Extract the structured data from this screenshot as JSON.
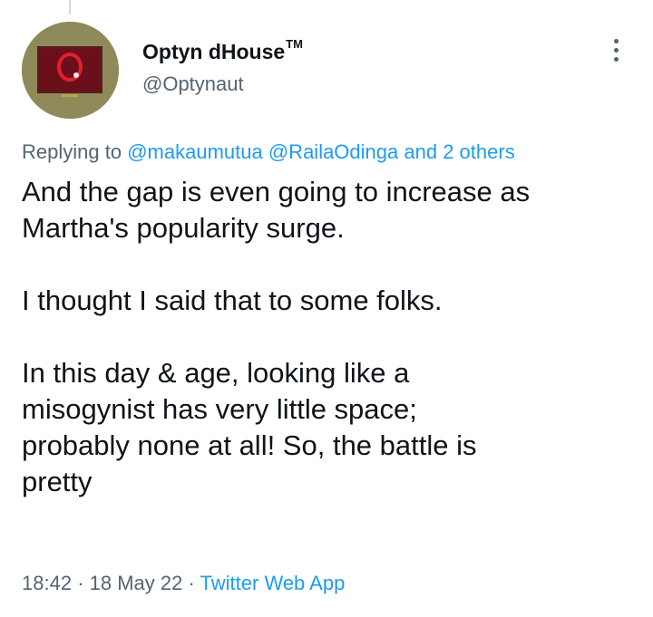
{
  "author": {
    "display_name": "Optyn dHouse",
    "trademark": "TM",
    "handle": "@Optynaut"
  },
  "reply_context": {
    "prefix": "Replying to",
    "mention_1": "@makaumutua",
    "mention_2": "@RailaOdinga",
    "others": "and 2 others"
  },
  "tweet": {
    "line_1": "And the gap is even going to increase as",
    "line_2": "Martha's popularity surge.",
    "line_3": "I thought I said that to some folks.",
    "line_4": "In this day & age, looking like a",
    "line_5": "misogynist has very little space;",
    "line_6": "probably none at all! So, the battle is",
    "line_7": "pretty"
  },
  "meta": {
    "time": "18:42",
    "sep_1": "·",
    "date": "18 May 22",
    "sep_2": "·",
    "source": "Twitter Web App"
  },
  "colors": {
    "text": "#0f1419",
    "secondary": "#536471",
    "link": "#1d9bf0",
    "avatar_bg": "#8f8a5a",
    "avatar_inner": "#6b0f1a"
  },
  "icons": {
    "more": "more-vertical-icon",
    "avatar": "avatar-logo"
  }
}
